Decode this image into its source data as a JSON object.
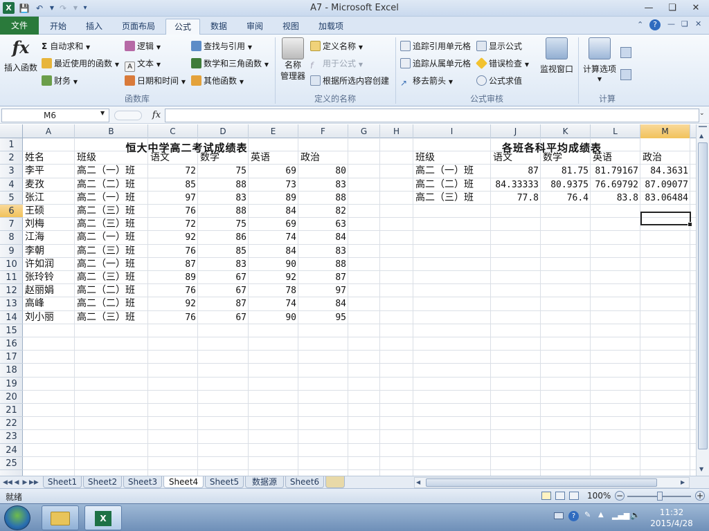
{
  "window": {
    "title": "A7  -  Microsoft Excel",
    "app_icon": "X"
  },
  "ribbon_tabs": [
    "文件",
    "开始",
    "插入",
    "页面布局",
    "公式",
    "数据",
    "审阅",
    "视图",
    "加载项"
  ],
  "ribbon": {
    "insert_function": "插入函数",
    "function_library": {
      "autosum": "自动求和",
      "recent": "最近使用的函数",
      "financial": "财务",
      "logical": "逻辑",
      "text": "文本",
      "datetime": "日期和时间",
      "lookup": "查找与引用",
      "math": "数学和三角函数",
      "other": "其他函数",
      "label": "函数库"
    },
    "defined_names": {
      "name_manager_1": "名称",
      "name_manager_2": "管理器",
      "define_name": "定义名称",
      "use_in_formula": "用于公式",
      "create_from_selection": "根据所选内容创建",
      "label": "定义的名称"
    },
    "formula_auditing": {
      "trace_precedents": "追踪引用单元格",
      "trace_dependents": "追踪从属单元格",
      "remove_arrows": "移去箭头",
      "show_formulas": "显示公式",
      "error_checking": "错误检查",
      "evaluate_formula": "公式求值",
      "label": "公式审核"
    },
    "watch_window": "监视窗口",
    "calculation": {
      "options": "计算选项",
      "label": "计算"
    }
  },
  "formula_bar": {
    "name_box": "M6",
    "fx": "fx",
    "content": ""
  },
  "columns": [
    "A",
    "B",
    "C",
    "D",
    "E",
    "F",
    "G",
    "H",
    "I",
    "J",
    "K",
    "L",
    "M"
  ],
  "rows": [
    "1",
    "2",
    "3",
    "4",
    "5",
    "6",
    "7",
    "8",
    "9",
    "10",
    "11",
    "12",
    "13",
    "14",
    "15",
    "16",
    "17",
    "18",
    "19",
    "20",
    "21",
    "22",
    "23",
    "24",
    "25"
  ],
  "table1": {
    "title": "恒大中学高二考试成绩表",
    "headers": [
      "姓名",
      "班级",
      "语文",
      "数学",
      "英语",
      "政治"
    ],
    "rows": [
      [
        "李平",
        "高二（一）班",
        "72",
        "75",
        "69",
        "80"
      ],
      [
        "麦孜",
        "高二（二）班",
        "85",
        "88",
        "73",
        "83"
      ],
      [
        "张江",
        "高二（一）班",
        "97",
        "83",
        "89",
        "88"
      ],
      [
        "王硕",
        "高二（三）班",
        "76",
        "88",
        "84",
        "82"
      ],
      [
        "刘梅",
        "高二（三）班",
        "72",
        "75",
        "69",
        "63"
      ],
      [
        "江海",
        "高二（一）班",
        "92",
        "86",
        "74",
        "84"
      ],
      [
        "李朝",
        "高二（三）班",
        "76",
        "85",
        "84",
        "83"
      ],
      [
        "许如润",
        "高二（一）班",
        "87",
        "83",
        "90",
        "88"
      ],
      [
        "张玲铃",
        "高二（三）班",
        "89",
        "67",
        "92",
        "87"
      ],
      [
        "赵丽娟",
        "高二（二）班",
        "76",
        "67",
        "78",
        "97"
      ],
      [
        "高峰",
        "高二（二）班",
        "92",
        "87",
        "74",
        "84"
      ],
      [
        "刘小丽",
        "高二（三）班",
        "76",
        "67",
        "90",
        "95"
      ]
    ]
  },
  "table2": {
    "title": "各班各科平均成绩表",
    "headers": [
      "班级",
      "语文",
      "数学",
      "英语",
      "政治"
    ],
    "rows": [
      [
        "高二（一）班",
        "87",
        "81.75",
        "81.79167",
        "84.3631"
      ],
      [
        "高二（二）班",
        "84.33333",
        "80.9375",
        "76.69792",
        "87.09077"
      ],
      [
        "高二（三）班",
        "77.8",
        "76.4",
        "83.8",
        "83.06484"
      ]
    ]
  },
  "sheets": [
    "Sheet1",
    "Sheet2",
    "Sheet3",
    "Sheet4",
    "Sheet5",
    "数据源",
    "Sheet6"
  ],
  "active_sheet": "Sheet4",
  "status": {
    "ready": "就绪",
    "zoom": "100%"
  },
  "taskbar": {
    "time": "11:32",
    "date": "2015/4/28"
  }
}
